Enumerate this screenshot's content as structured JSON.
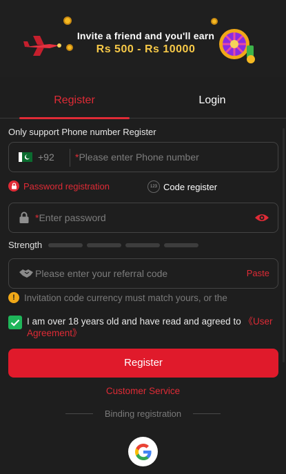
{
  "banner": {
    "line1": "Invite a friend and you'll earn",
    "line2": "Rs 500 - Rs 10000"
  },
  "tabs": [
    {
      "label": "Register",
      "active": true
    },
    {
      "label": "Login",
      "active": false
    }
  ],
  "form": {
    "note": "Only support Phone number Register",
    "phone": {
      "prefix": "+92",
      "required_mark": "*",
      "placeholder": "Please enter Phone number"
    },
    "modes": {
      "password": "Password registration",
      "code": "Code register",
      "code_badge": "123"
    },
    "password": {
      "required_mark": "*",
      "placeholder": "Enter password"
    },
    "strength_label": "Strength",
    "strength_level": 0,
    "referral": {
      "placeholder": "Please enter your referral code",
      "paste": "Paste"
    },
    "warning": "Invitation code currency must match yours, or the",
    "agree": {
      "text": "I am over 18 years old and have read and agreed to ",
      "link": "《User Agreement》",
      "checked": true
    },
    "submit": "Register"
  },
  "customer_service": "Customer Service",
  "binding": "Binding registration",
  "colors": {
    "accent": "#e02b36",
    "background": "#1e1e1e",
    "check": "#1fb65a",
    "gold": "#f7c948"
  }
}
